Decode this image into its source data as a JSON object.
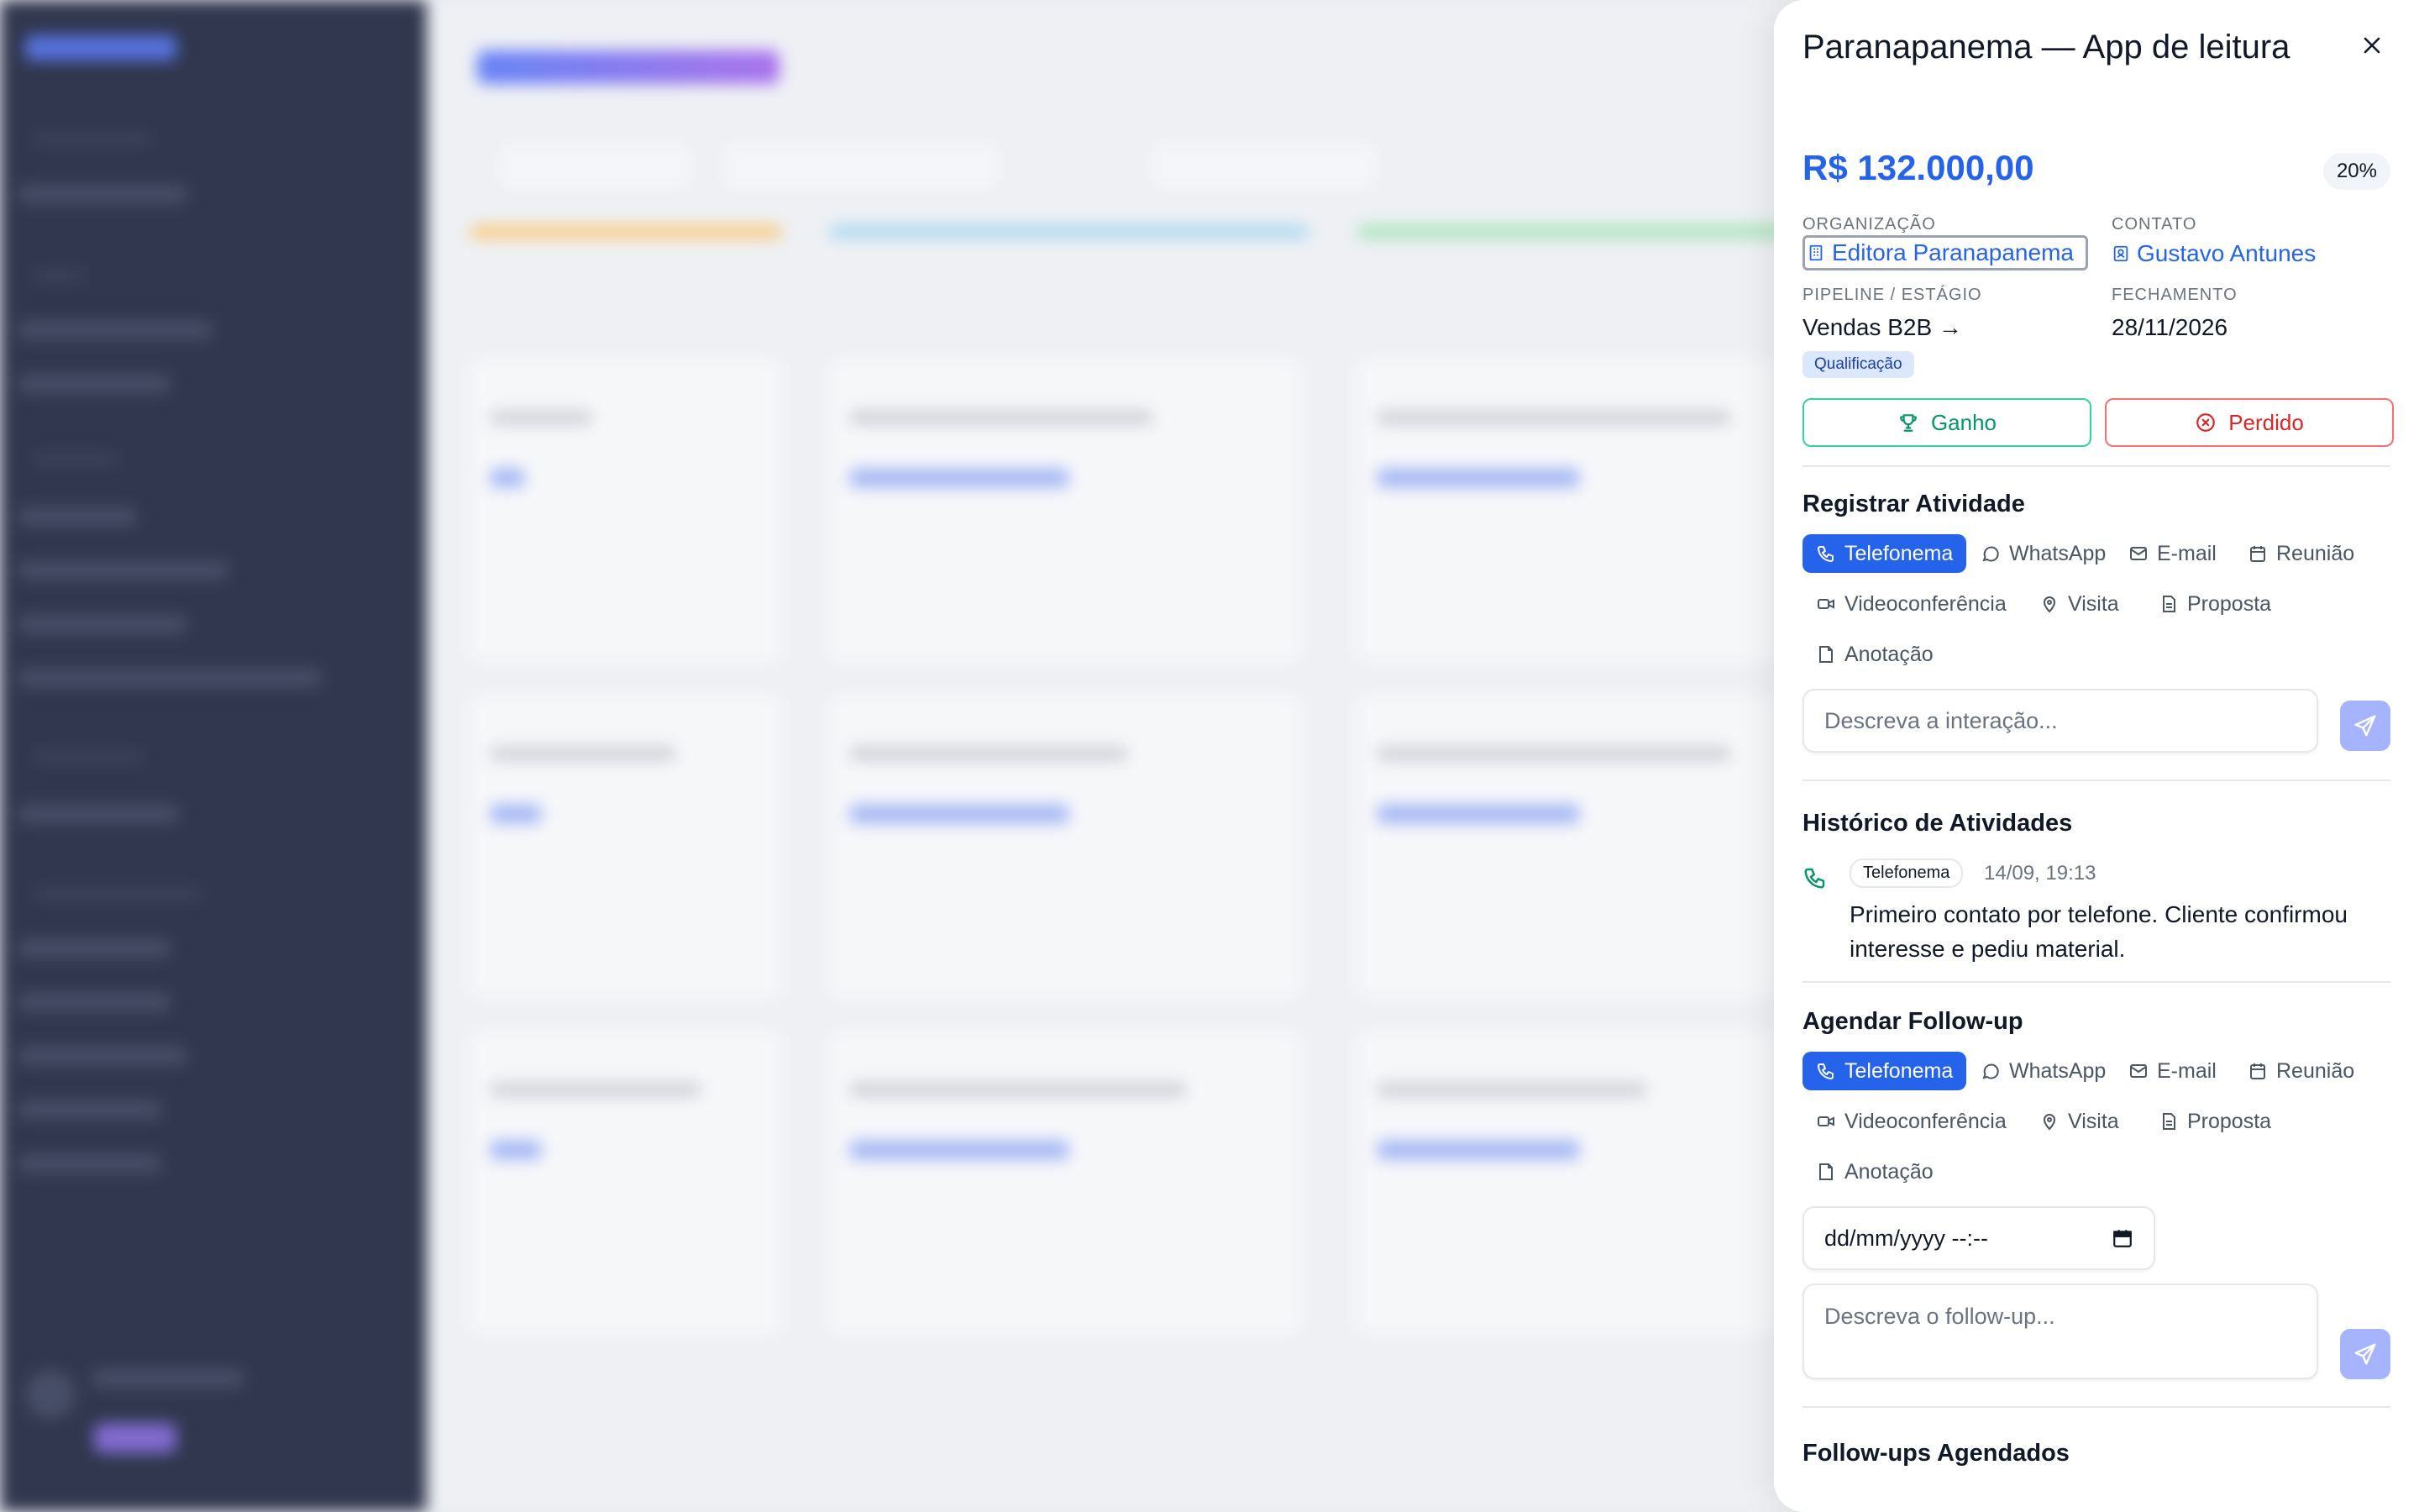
{
  "drawer": {
    "title": "Paranapanema — App de leitura",
    "value": "R$ 132.000,00",
    "probability": "20%",
    "organization": {
      "label": "ORGANIZAÇÃO",
      "value": "Editora Paranapanema"
    },
    "contact": {
      "label": "CONTATO",
      "value": "Gustavo Antunes"
    },
    "pipeline": {
      "label": "PIPELINE / ESTÁGIO",
      "value": "Vendas B2B →",
      "stage": "Qualificação"
    },
    "closing": {
      "label": "FECHAMENTO",
      "value": "28/11/2026"
    },
    "won_label": "Ganho",
    "lost_label": "Perdido"
  },
  "register": {
    "title": "Registrar Atividade",
    "types": [
      "Telefonema",
      "WhatsApp",
      "E-mail",
      "Reunião",
      "Videoconferência",
      "Visita",
      "Proposta",
      "Anotação"
    ],
    "active_type": "Telefonema",
    "placeholder": "Descreva a interação..."
  },
  "history": {
    "title": "Histórico de Atividades",
    "items": [
      {
        "type": "Telefonema",
        "time": "14/09, 19:13",
        "text": "Primeiro contato por telefone. Cliente confirmou interesse e pediu material."
      }
    ]
  },
  "followup": {
    "title": "Agendar Follow-up",
    "types": [
      "Telefonema",
      "WhatsApp",
      "E-mail",
      "Reunião",
      "Videoconferência",
      "Visita",
      "Proposta",
      "Anotação"
    ],
    "active_type": "Telefonema",
    "datetime_placeholder": "dd/mm/yyyy --:--",
    "placeholder": "Descreva o follow-up..."
  },
  "scheduled": {
    "title": "Follow-ups Agendados"
  },
  "colors": {
    "accent": "#2563eb",
    "won": "#059669",
    "lost": "#dc2626",
    "send": "#a5b4fc"
  }
}
